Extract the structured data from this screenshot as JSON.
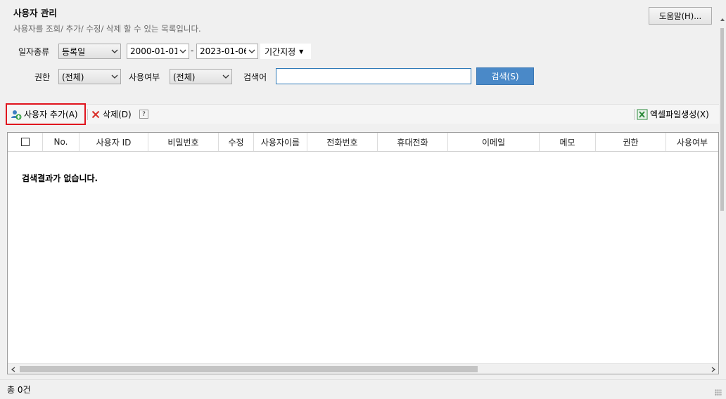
{
  "header": {
    "title": "사용자 관리",
    "subtitle": "사용자를 조회/ 추가/ 수정/ 삭제 할 수 있는 목록입니다.",
    "help_label": "도움말(H)..."
  },
  "filters": {
    "date_type_label": "일자종류",
    "date_type_value": "등록일",
    "date_from": "2000-01-01",
    "date_separator": "-",
    "date_to": "2023-01-06",
    "period_label": "기간지정",
    "permission_label": "권한",
    "permission_value": "(전체)",
    "usage_label": "사용여부",
    "usage_value": "(전체)",
    "search_label": "검색어",
    "search_value": "",
    "search_button": "검색(S)"
  },
  "toolbar": {
    "add_user": "사용자 추가(A)",
    "delete": "삭제(D)",
    "help_icon_text": "?",
    "excel_export": "엑셀파일생성(X)"
  },
  "table": {
    "columns": [
      "No.",
      "사용자 ID",
      "비밀번호",
      "수정",
      "사용자이름",
      "전화번호",
      "휴대전화",
      "이메일",
      "메모",
      "권한",
      "사용여부"
    ],
    "empty_message": "검색결과가 없습니다."
  },
  "status": {
    "total_text": "총 0건"
  },
  "colors": {
    "accent": "#4a89c8",
    "highlight": "#e0141e",
    "delete_icon": "#d9302a",
    "excel_icon": "#2e8b3d"
  },
  "icons": [
    "add-user-icon",
    "delete-icon",
    "help-icon",
    "excel-icon",
    "chevron-down-icon"
  ]
}
